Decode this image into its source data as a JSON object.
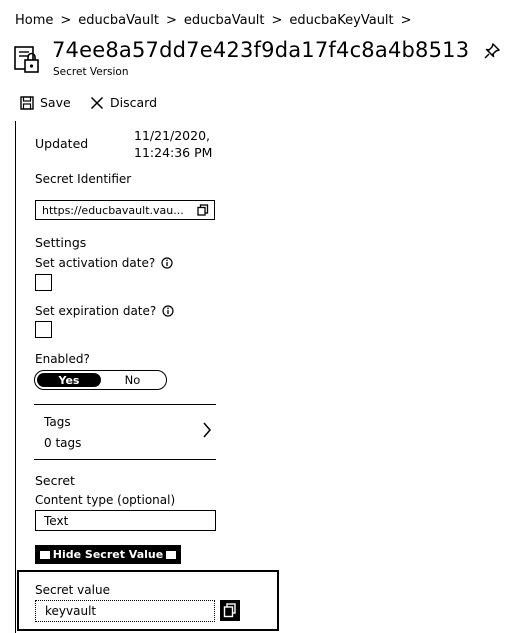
{
  "breadcrumb": {
    "items": [
      "Home",
      "educbaVault",
      "educbaVault",
      "educbaKeyVault"
    ],
    "separator": ">"
  },
  "header": {
    "title": "74ee8a57dd7e423f9da17f4c8a4b8513",
    "subtitle": "Secret Version",
    "icon": "key-vault-secret-icon",
    "pin_icon": "pin-icon"
  },
  "toolbar": {
    "save_label": "Save",
    "discard_label": "Discard"
  },
  "details": {
    "updated_label": "Updated",
    "updated_value_line1": "11/21/2020,",
    "updated_value_line2": "11:24:36 PM",
    "secret_identifier_label": "Secret Identifier",
    "secret_identifier_value": "https://educbavault.vau..."
  },
  "settings": {
    "heading": "Settings",
    "activation_label": "Set activation date?",
    "activation_checked": false,
    "expiration_label": "Set expiration date?",
    "expiration_checked": false,
    "enabled_label": "Enabled?",
    "enabled_yes": "Yes",
    "enabled_no": "No",
    "enabled_selected": "Yes"
  },
  "tags": {
    "label": "Tags",
    "count_text": "0 tags"
  },
  "secret": {
    "heading": "Secret",
    "content_type_label": "Content type (optional)",
    "content_type_value": "Text",
    "hide_button_label": "Hide Secret Value",
    "secret_value_label": "Secret value",
    "secret_value": "keyvault"
  }
}
